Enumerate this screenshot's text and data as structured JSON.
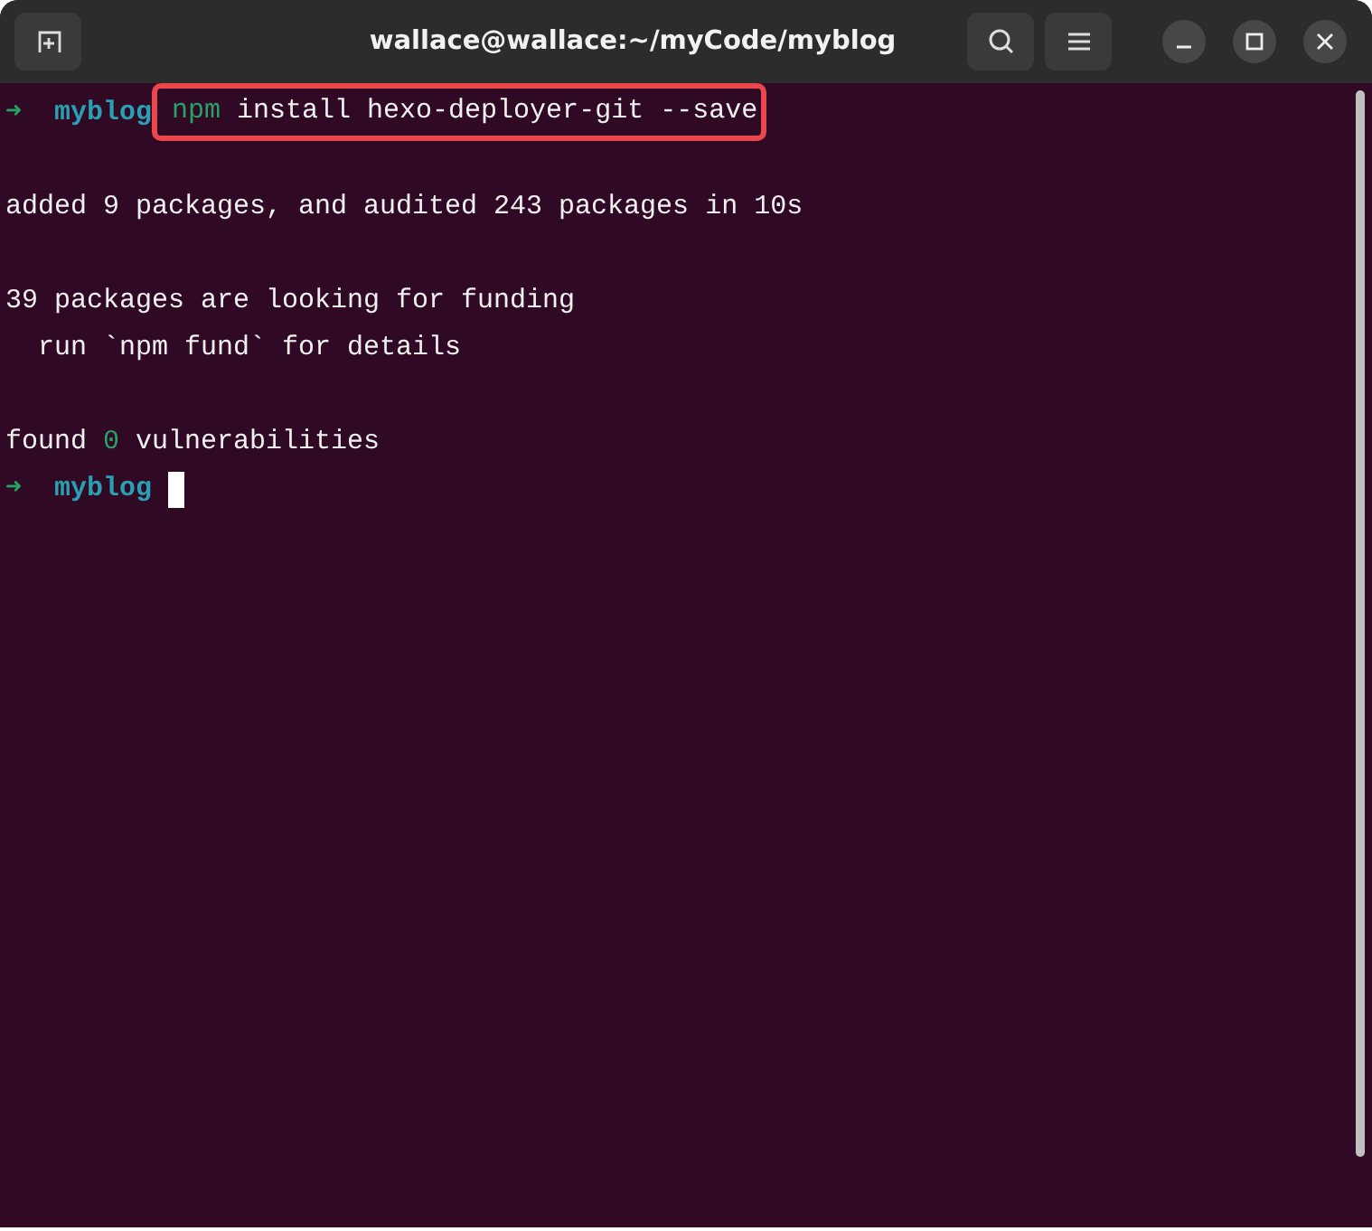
{
  "window": {
    "title": "wallace@wallace:~/myCode/myblog"
  },
  "terminal": {
    "blocks": [
      {
        "kind": "prompt",
        "arrow": "➜",
        "dir": "myblog",
        "command": [
          {
            "text": "npm",
            "kind": "program"
          },
          {
            "text": " install hexo-deployer-git --save",
            "kind": "args"
          }
        ],
        "highlighted": true
      },
      {
        "kind": "output",
        "lines": [
          [
            {
              "text": "added 9 packages, and audited 243 packages in 10s",
              "kind": "plain"
            }
          ]
        ]
      },
      {
        "kind": "output",
        "lines": [
          [
            {
              "text": "39 packages are looking for funding",
              "kind": "plain"
            }
          ],
          [
            {
              "text": "  run `npm fund` for details",
              "kind": "plain"
            }
          ]
        ]
      },
      {
        "kind": "output",
        "lines": [
          [
            {
              "text": "found ",
              "kind": "plain"
            },
            {
              "text": "0",
              "kind": "number"
            },
            {
              "text": " vulnerabilities",
              "kind": "plain"
            }
          ]
        ]
      },
      {
        "kind": "prompt",
        "arrow": "➜",
        "dir": "myblog",
        "cursor": true
      }
    ]
  }
}
